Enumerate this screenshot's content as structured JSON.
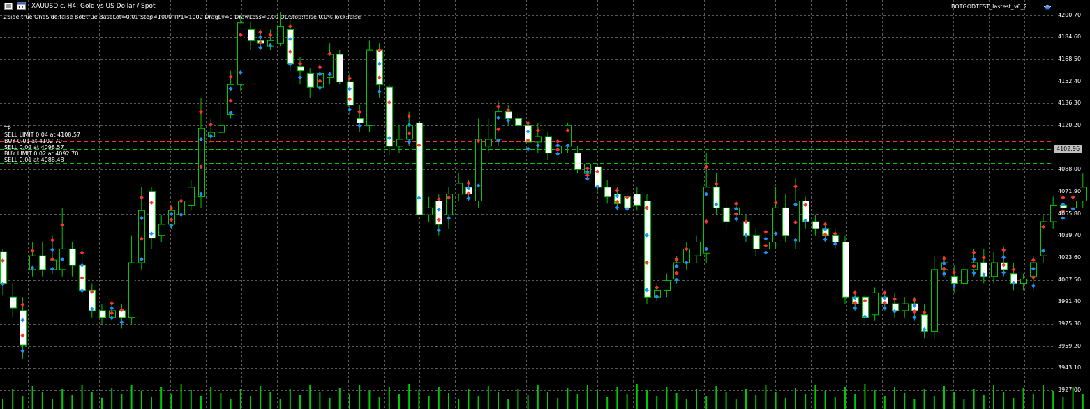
{
  "chart_header": {
    "menu_icon": "list-icon",
    "chart_icon": "window-icon",
    "symbol_line": "XAUUSD.c, H4:  Gold vs US Dollar / Spot",
    "params_line": "2Side:true  OneSide:false  Bot:true  BaseLot=0.01  Step=1000  TP1=1000  DragLv=0  DrawLoss=0.00  DDStop:false 0.0% lock:false",
    "ea_name": "BOTGODTEST_lastest_v6_2",
    "ea_icon": "graduation-cap-icon"
  },
  "colors": {
    "background": "#000000",
    "grid": "#5a5a5a",
    "bull_body": "#000000",
    "bear_body": "#ffffff",
    "candle_outline": "#00c800",
    "volume": "#00c800",
    "sell_line": "#ff3030",
    "buy_line": "#00c800",
    "tp_line": "#c0c0c0",
    "sell_marker": "#ff3030",
    "buy_marker": "#1e90ff"
  },
  "order_labels": [
    {
      "text": "TP",
      "price": 4113.0
    },
    {
      "text": "SELL LIMIT 0.04 at 4108.57",
      "price": 4108.57
    },
    {
      "text": "BUY 0.01 at 4102.70",
      "price": 4102.7
    },
    {
      "text": "SELL 0.02 at 4098.57",
      "price": 4098.57
    },
    {
      "text": "BUY LIMIT 0.02 at 4092.70",
      "price": 4092.7
    },
    {
      "text": "SELL 0.01 at 4088.48",
      "price": 4088.48
    }
  ],
  "order_lines": [
    {
      "price": 4108.57,
      "type": "sell",
      "style": "dash"
    },
    {
      "price": 4102.7,
      "type": "buy",
      "style": "dash"
    },
    {
      "price": 4098.57,
      "type": "sell",
      "style": "solid"
    },
    {
      "price": 4092.7,
      "type": "buy",
      "style": "dash"
    },
    {
      "price": 4088.48,
      "type": "sell",
      "style": "dash"
    }
  ],
  "current_price": "4102.96",
  "chart_data": {
    "type": "candlestick",
    "symbol": "XAUUSD.c",
    "timeframe": "H4",
    "ylim": [
      3927.0,
      4203.0
    ],
    "y_ticks": [
      "4200.70",
      "4184.60",
      "4168.50",
      "4152.40",
      "4136.30",
      "4120.20",
      "4104.10",
      "4088.00",
      "4071.90",
      "4055.80",
      "4039.70",
      "4023.60",
      "4007.50",
      "3991.40",
      "3975.30",
      "3959.20",
      "3943.10",
      "3927.00"
    ],
    "y_tick_values": [
      4200.7,
      4184.6,
      4168.5,
      4152.4,
      4136.3,
      4120.2,
      4104.1,
      4088.0,
      4071.9,
      4055.8,
      4039.7,
      4023.6,
      4007.5,
      3991.4,
      3975.3,
      3959.2,
      3943.1,
      3927.0
    ],
    "grid": true,
    "candles": [
      [
        4028,
        4005,
        3996,
        4030
      ],
      [
        3995,
        3987,
        3980,
        4005
      ],
      [
        3985,
        3960,
        3950,
        3995
      ],
      [
        4015,
        4025,
        4010,
        4035
      ],
      [
        4025,
        4015,
        4010,
        4035
      ],
      [
        4015,
        4022,
        4012,
        4040
      ],
      [
        4015,
        4030,
        4010,
        4060
      ],
      [
        4030,
        4018,
        4010,
        4035
      ],
      [
        4018,
        4000,
        3995,
        4032
      ],
      [
        4000,
        3985,
        3980,
        4005
      ],
      [
        3985,
        3980,
        3975,
        3990
      ],
      [
        3980,
        3985,
        3978,
        3992
      ],
      [
        3985,
        3980,
        3972,
        3990
      ],
      [
        3980,
        4020,
        3975,
        4040
      ],
      [
        4020,
        4058,
        4015,
        4075
      ],
      [
        4072,
        4038,
        4030,
        4075
      ],
      [
        4040,
        4048,
        4035,
        4055
      ],
      [
        4048,
        4058,
        4045,
        4062
      ],
      [
        4055,
        4065,
        4050,
        4070
      ],
      [
        4062,
        4075,
        4058,
        4080
      ],
      [
        4068,
        4118,
        4060,
        4140
      ],
      [
        4112,
        4115,
        4108,
        4125
      ],
      [
        4115,
        4120,
        4110,
        4140
      ],
      [
        4128,
        4150,
        4125,
        4160
      ],
      [
        4150,
        4195,
        4145,
        4200
      ],
      [
        4190,
        4182,
        4175,
        4196
      ],
      [
        4182,
        4180,
        4175,
        4190
      ],
      [
        4178,
        4182,
        4175,
        4190
      ],
      [
        4180,
        4192,
        4178,
        4203
      ],
      [
        4190,
        4165,
        4160,
        4197
      ],
      [
        4163,
        4160,
        4150,
        4170
      ],
      [
        4158,
        4148,
        4140,
        4162
      ],
      [
        4148,
        4158,
        4145,
        4165
      ],
      [
        4155,
        4172,
        4150,
        4180
      ],
      [
        4172,
        4152,
        4150,
        4175
      ],
      [
        4152,
        4135,
        4128,
        4158
      ],
      [
        4125,
        4122,
        4115,
        4135
      ],
      [
        4120,
        4175,
        4115,
        4182
      ],
      [
        4175,
        4150,
        4140,
        4180
      ],
      [
        4148,
        4105,
        4098,
        4150
      ],
      [
        4105,
        4110,
        4100,
        4120
      ],
      [
        4110,
        4120,
        4105,
        4130
      ],
      [
        4122,
        4055,
        4048,
        4125
      ],
      [
        4055,
        4060,
        4050,
        4068
      ],
      [
        4065,
        4048,
        4040,
        4070
      ],
      [
        4055,
        4070,
        4045,
        4075
      ],
      [
        4070,
        4078,
        4065,
        4085
      ],
      [
        4075,
        4070,
        4065,
        4080
      ],
      [
        4065,
        4110,
        4060,
        4125
      ],
      [
        4105,
        4110,
        4100,
        4125
      ],
      [
        4110,
        4130,
        4105,
        4138
      ],
      [
        4130,
        4125,
        4120,
        4135
      ],
      [
        4125,
        4120,
        4115,
        4130
      ],
      [
        4120,
        4108,
        4100,
        4125
      ],
      [
        4108,
        4112,
        4100,
        4122
      ],
      [
        4112,
        4100,
        4095,
        4115
      ],
      [
        4100,
        4105,
        4098,
        4110
      ],
      [
        4105,
        4120,
        4100,
        4122
      ],
      [
        4100,
        4088,
        4085,
        4105
      ],
      [
        4085,
        4092,
        4080,
        4090
      ],
      [
        4090,
        4075,
        4070,
        4092
      ],
      [
        4075,
        4068,
        4063,
        4080
      ],
      [
        4070,
        4063,
        4058,
        4075
      ],
      [
        4068,
        4060,
        4055,
        4072
      ],
      [
        4070,
        4062,
        4058,
        4075
      ],
      [
        4065,
        3995,
        3990,
        4070
      ],
      [
        3995,
        4000,
        3992,
        4005
      ],
      [
        4000,
        4007,
        3995,
        4012
      ],
      [
        4008,
        4020,
        4005,
        4025
      ],
      [
        4020,
        4030,
        4015,
        4035
      ],
      [
        4025,
        4035,
        4020,
        4040
      ],
      [
        4027,
        4075,
        4020,
        4100
      ],
      [
        4075,
        4060,
        4055,
        4085
      ],
      [
        4060,
        4050,
        4045,
        4065
      ],
      [
        4055,
        4060,
        4050,
        4065
      ],
      [
        4050,
        4040,
        4035,
        4055
      ],
      [
        4040,
        4030,
        4025,
        4045
      ],
      [
        4030,
        4035,
        4025,
        4045
      ],
      [
        4035,
        4060,
        4030,
        4075
      ],
      [
        4060,
        4040,
        4035,
        4070
      ],
      [
        4035,
        4065,
        4030,
        4082
      ],
      [
        4065,
        4050,
        4045,
        4068
      ],
      [
        4050,
        4045,
        4040,
        4055
      ],
      [
        4045,
        4040,
        4035,
        4050
      ],
      [
        4040,
        4035,
        4030,
        4045
      ],
      [
        4035,
        3995,
        3990,
        4040
      ],
      [
        3995,
        3990,
        3985,
        4000
      ],
      [
        3995,
        3980,
        3975,
        3998
      ],
      [
        3982,
        3998,
        3978,
        4002
      ],
      [
        3995,
        3990,
        3985,
        4000
      ],
      [
        3990,
        3985,
        3980,
        3998
      ],
      [
        3985,
        3990,
        3980,
        3995
      ],
      [
        3990,
        3985,
        3978,
        3995
      ],
      [
        3982,
        3970,
        3965,
        3990
      ],
      [
        3970,
        4015,
        3965,
        4025
      ],
      [
        4015,
        4020,
        4010,
        4025
      ],
      [
        4010,
        4005,
        3998,
        4018
      ],
      [
        4005,
        4015,
        4000,
        4020
      ],
      [
        4015,
        4020,
        4010,
        4030
      ],
      [
        4020,
        4010,
        4005,
        4030
      ],
      [
        4010,
        4020,
        4005,
        4028
      ],
      [
        4020,
        4015,
        4010,
        4032
      ],
      [
        4012,
        4005,
        4000,
        4020
      ],
      [
        4005,
        4008,
        4000,
        4012
      ],
      [
        4010,
        4020,
        4000,
        4025
      ],
      [
        4025,
        4050,
        4020,
        4055
      ],
      [
        4050,
        4062,
        4045,
        4068
      ],
      [
        4062,
        4060,
        4050,
        4070
      ],
      [
        4060,
        4065,
        4055,
        4072
      ],
      [
        4065,
        4075,
        4060,
        4085
      ]
    ]
  }
}
